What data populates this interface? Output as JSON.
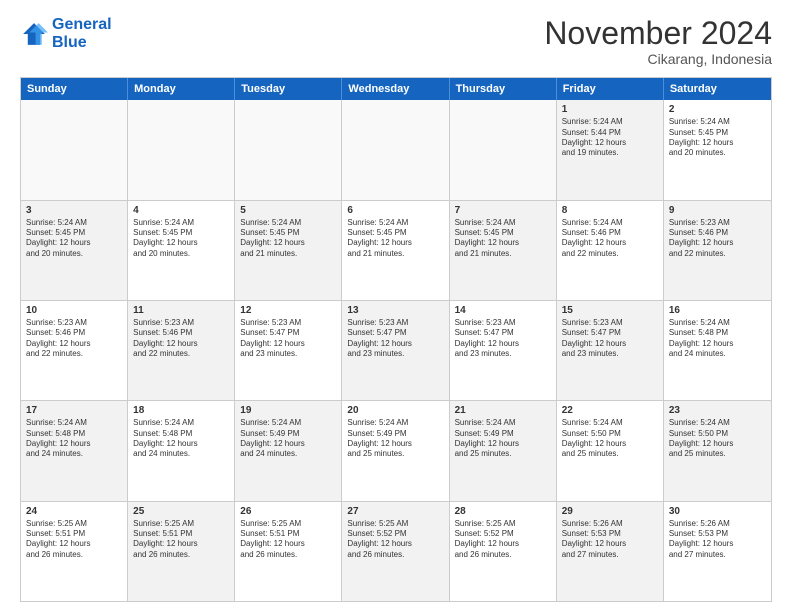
{
  "logo": {
    "line1": "General",
    "line2": "Blue"
  },
  "title": "November 2024",
  "location": "Cikarang, Indonesia",
  "weekdays": [
    "Sunday",
    "Monday",
    "Tuesday",
    "Wednesday",
    "Thursday",
    "Friday",
    "Saturday"
  ],
  "rows": [
    [
      {
        "day": "",
        "text": "",
        "empty": true
      },
      {
        "day": "",
        "text": "",
        "empty": true
      },
      {
        "day": "",
        "text": "",
        "empty": true
      },
      {
        "day": "",
        "text": "",
        "empty": true
      },
      {
        "day": "",
        "text": "",
        "empty": true
      },
      {
        "day": "1",
        "text": "Sunrise: 5:24 AM\nSunset: 5:44 PM\nDaylight: 12 hours\nand 19 minutes.",
        "shaded": true
      },
      {
        "day": "2",
        "text": "Sunrise: 5:24 AM\nSunset: 5:45 PM\nDaylight: 12 hours\nand 20 minutes.",
        "shaded": false
      }
    ],
    [
      {
        "day": "3",
        "text": "Sunrise: 5:24 AM\nSunset: 5:45 PM\nDaylight: 12 hours\nand 20 minutes.",
        "shaded": true
      },
      {
        "day": "4",
        "text": "Sunrise: 5:24 AM\nSunset: 5:45 PM\nDaylight: 12 hours\nand 20 minutes.",
        "shaded": false
      },
      {
        "day": "5",
        "text": "Sunrise: 5:24 AM\nSunset: 5:45 PM\nDaylight: 12 hours\nand 21 minutes.",
        "shaded": true
      },
      {
        "day": "6",
        "text": "Sunrise: 5:24 AM\nSunset: 5:45 PM\nDaylight: 12 hours\nand 21 minutes.",
        "shaded": false
      },
      {
        "day": "7",
        "text": "Sunrise: 5:24 AM\nSunset: 5:45 PM\nDaylight: 12 hours\nand 21 minutes.",
        "shaded": true
      },
      {
        "day": "8",
        "text": "Sunrise: 5:24 AM\nSunset: 5:46 PM\nDaylight: 12 hours\nand 22 minutes.",
        "shaded": false
      },
      {
        "day": "9",
        "text": "Sunrise: 5:23 AM\nSunset: 5:46 PM\nDaylight: 12 hours\nand 22 minutes.",
        "shaded": true
      }
    ],
    [
      {
        "day": "10",
        "text": "Sunrise: 5:23 AM\nSunset: 5:46 PM\nDaylight: 12 hours\nand 22 minutes.",
        "shaded": false
      },
      {
        "day": "11",
        "text": "Sunrise: 5:23 AM\nSunset: 5:46 PM\nDaylight: 12 hours\nand 22 minutes.",
        "shaded": true
      },
      {
        "day": "12",
        "text": "Sunrise: 5:23 AM\nSunset: 5:47 PM\nDaylight: 12 hours\nand 23 minutes.",
        "shaded": false
      },
      {
        "day": "13",
        "text": "Sunrise: 5:23 AM\nSunset: 5:47 PM\nDaylight: 12 hours\nand 23 minutes.",
        "shaded": true
      },
      {
        "day": "14",
        "text": "Sunrise: 5:23 AM\nSunset: 5:47 PM\nDaylight: 12 hours\nand 23 minutes.",
        "shaded": false
      },
      {
        "day": "15",
        "text": "Sunrise: 5:23 AM\nSunset: 5:47 PM\nDaylight: 12 hours\nand 23 minutes.",
        "shaded": true
      },
      {
        "day": "16",
        "text": "Sunrise: 5:24 AM\nSunset: 5:48 PM\nDaylight: 12 hours\nand 24 minutes.",
        "shaded": false
      }
    ],
    [
      {
        "day": "17",
        "text": "Sunrise: 5:24 AM\nSunset: 5:48 PM\nDaylight: 12 hours\nand 24 minutes.",
        "shaded": true
      },
      {
        "day": "18",
        "text": "Sunrise: 5:24 AM\nSunset: 5:48 PM\nDaylight: 12 hours\nand 24 minutes.",
        "shaded": false
      },
      {
        "day": "19",
        "text": "Sunrise: 5:24 AM\nSunset: 5:49 PM\nDaylight: 12 hours\nand 24 minutes.",
        "shaded": true
      },
      {
        "day": "20",
        "text": "Sunrise: 5:24 AM\nSunset: 5:49 PM\nDaylight: 12 hours\nand 25 minutes.",
        "shaded": false
      },
      {
        "day": "21",
        "text": "Sunrise: 5:24 AM\nSunset: 5:49 PM\nDaylight: 12 hours\nand 25 minutes.",
        "shaded": true
      },
      {
        "day": "22",
        "text": "Sunrise: 5:24 AM\nSunset: 5:50 PM\nDaylight: 12 hours\nand 25 minutes.",
        "shaded": false
      },
      {
        "day": "23",
        "text": "Sunrise: 5:24 AM\nSunset: 5:50 PM\nDaylight: 12 hours\nand 25 minutes.",
        "shaded": true
      }
    ],
    [
      {
        "day": "24",
        "text": "Sunrise: 5:25 AM\nSunset: 5:51 PM\nDaylight: 12 hours\nand 26 minutes.",
        "shaded": false
      },
      {
        "day": "25",
        "text": "Sunrise: 5:25 AM\nSunset: 5:51 PM\nDaylight: 12 hours\nand 26 minutes.",
        "shaded": true
      },
      {
        "day": "26",
        "text": "Sunrise: 5:25 AM\nSunset: 5:51 PM\nDaylight: 12 hours\nand 26 minutes.",
        "shaded": false
      },
      {
        "day": "27",
        "text": "Sunrise: 5:25 AM\nSunset: 5:52 PM\nDaylight: 12 hours\nand 26 minutes.",
        "shaded": true
      },
      {
        "day": "28",
        "text": "Sunrise: 5:25 AM\nSunset: 5:52 PM\nDaylight: 12 hours\nand 26 minutes.",
        "shaded": false
      },
      {
        "day": "29",
        "text": "Sunrise: 5:26 AM\nSunset: 5:53 PM\nDaylight: 12 hours\nand 27 minutes.",
        "shaded": true
      },
      {
        "day": "30",
        "text": "Sunrise: 5:26 AM\nSunset: 5:53 PM\nDaylight: 12 hours\nand 27 minutes.",
        "shaded": false
      }
    ]
  ]
}
